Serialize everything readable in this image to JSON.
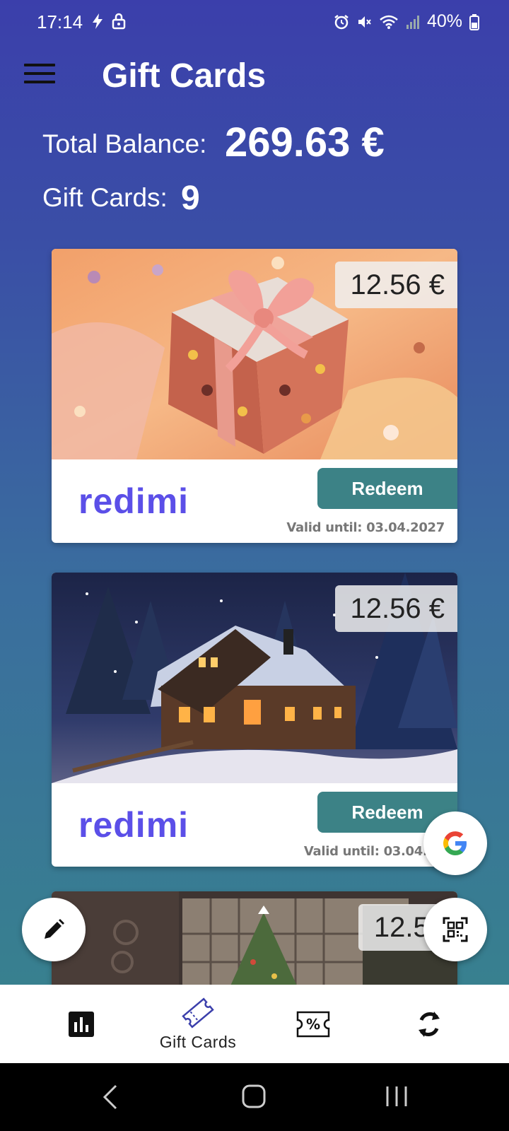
{
  "status_bar": {
    "time": "17:14",
    "battery": "40%"
  },
  "header": {
    "title": "Gift Cards"
  },
  "summary": {
    "balance_label": "Total Balance:",
    "balance_value": "269.63 €",
    "count_label": "Gift Cards:",
    "count_value": "9"
  },
  "cards": [
    {
      "amount": "12.56 €",
      "brand": "redimi",
      "redeem_label": "Redeem",
      "valid_until": "Valid until: 03.04.2027",
      "image": "wrapped-gift-box"
    },
    {
      "amount": "12.56 €",
      "brand": "redimi",
      "redeem_label": "Redeem",
      "valid_until": "Valid until: 03.04.20",
      "image": "snowy-cabin"
    },
    {
      "amount": "12.56",
      "image": "christmas-tree-window"
    }
  ],
  "fabs": {
    "edit": "pencil-icon",
    "google": "google-icon",
    "scan": "qr-scan-icon"
  },
  "bottom_nav": {
    "items": [
      {
        "icon": "bar-chart-icon"
      },
      {
        "icon": "ticket-icon",
        "label": "Gift Cards"
      },
      {
        "icon": "discount-ticket-icon"
      },
      {
        "icon": "sync-icon"
      }
    ]
  },
  "colors": {
    "accent": "#3c8286",
    "brand": "#5b4fe8",
    "header_bg": "#3b3fab"
  }
}
